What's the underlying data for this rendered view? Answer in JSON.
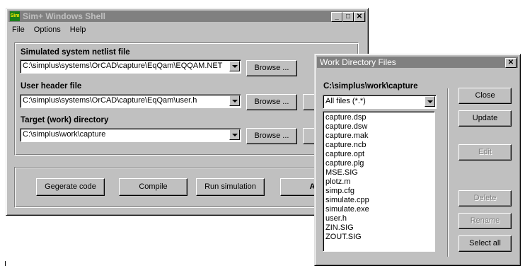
{
  "main_window": {
    "icon_text": "Sim",
    "title": "Sim+ Windows Shell",
    "menu": [
      "File",
      "Options",
      "Help"
    ],
    "netlist_label": "Simulated system netlist file",
    "netlist_value": "C:\\simplus\\systems\\OrCAD\\capture\\EqQam\\EQQAM.NET",
    "header_label": "User header file",
    "header_value": "C:\\simplus\\systems\\OrCAD\\capture\\EqQam\\user.h",
    "target_label": "Target (work) directory",
    "target_value": "C:\\simplus\\work\\capture",
    "browse": "Browse ...",
    "buttons": {
      "generate": "Gegerate code",
      "compile": "Compile",
      "run": "Run simulation",
      "all": "All"
    }
  },
  "work_dialog": {
    "title": "Work Directory Files",
    "close_glyph": "✕",
    "path": "C:\\simplus\\work\\capture",
    "filter": "All files (*.*)",
    "files": [
      "capture.dsp",
      "capture.dsw",
      "capture.mak",
      "capture.ncb",
      "capture.opt",
      "capture.plg",
      "MSE.SIG",
      "plotz.m",
      "simp.cfg",
      "simulate.cpp",
      "simulate.exe",
      "user.h",
      "ZIN.SIG",
      "ZOUT.SIG"
    ],
    "buttons": {
      "close": "Close",
      "update": "Update",
      "edit": "Edit",
      "delete": "Delete",
      "rename": "Rename",
      "select_all": "Select all"
    }
  }
}
